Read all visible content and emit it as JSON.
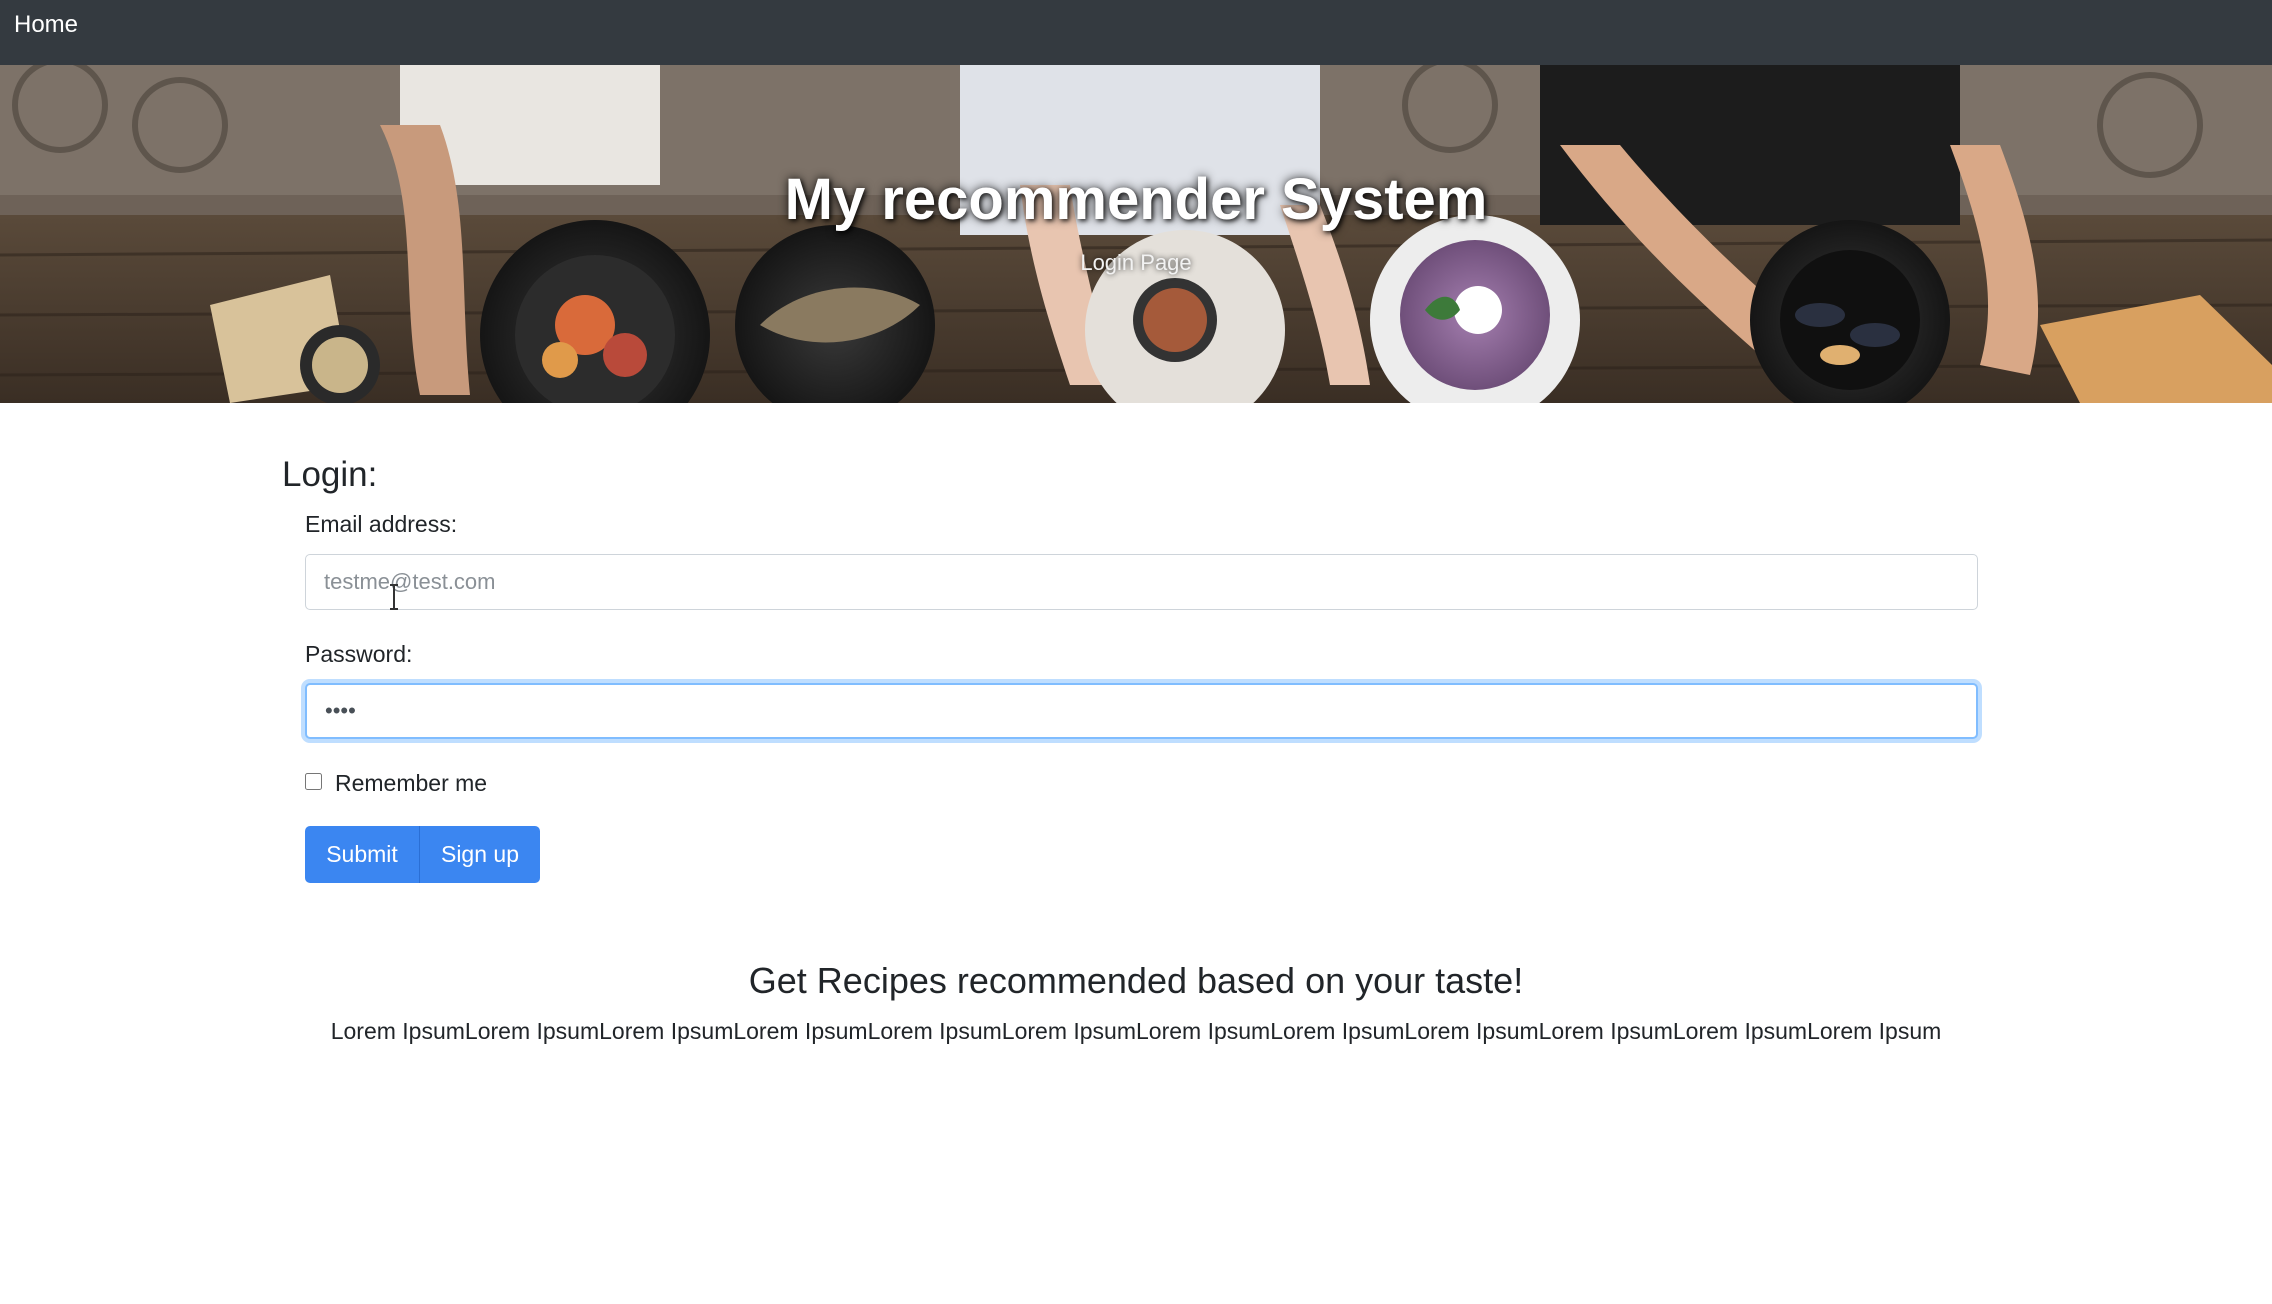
{
  "navbar": {
    "home_label": "Home"
  },
  "hero": {
    "title": "My recommender System",
    "subtitle": "Login Page"
  },
  "login": {
    "heading": "Login:",
    "email_label": "Email address:",
    "email_placeholder": "testme@test.com",
    "email_value": "",
    "password_label": "Password:",
    "password_value": "••••",
    "remember_label": "Remember me",
    "remember_checked": false,
    "submit_label": "Submit",
    "signup_label": "Sign up"
  },
  "promo": {
    "title": "Get Recipes recommended based on your taste!",
    "text": "Lorem IpsumLorem IpsumLorem IpsumLorem IpsumLorem IpsumLorem IpsumLorem IpsumLorem IpsumLorem IpsumLorem IpsumLorem IpsumLorem Ipsum"
  },
  "colors": {
    "navbar_bg": "#343a40",
    "primary": "#3b86f1",
    "focus_border": "#80bdff"
  }
}
